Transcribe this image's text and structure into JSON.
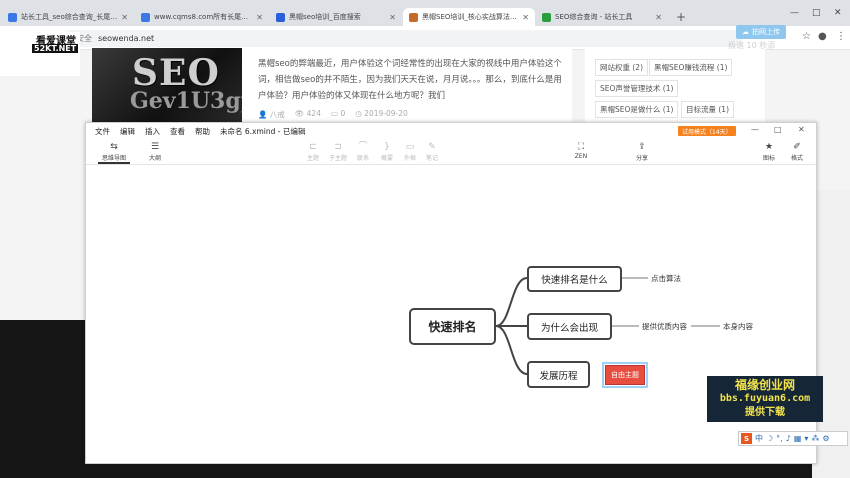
{
  "browser": {
    "tabs": [
      {
        "title": "站长工具_seo综合查询_长尾关键",
        "color": "#3b78e7",
        "active": false
      },
      {
        "title": "www.cqms8.com所有长尾词排",
        "color": "#3b78e7",
        "active": false
      },
      {
        "title": "黑帽seo培训_百度搜索",
        "color": "#2b5fd9",
        "active": false
      },
      {
        "title": "黑帽SEO培训_核心实战算法技术",
        "color": "#c66a2a",
        "active": true
      },
      {
        "title": "SEO综合查询 - 站长工具",
        "color": "#2a9d3c",
        "active": false
      }
    ],
    "new_tab": "+",
    "address": {
      "security": "不安全",
      "url": "seowenda.net"
    },
    "minimize": "—",
    "maximize": "□",
    "close": "✕"
  },
  "overlay_logo": {
    "line1": "看爱课堂",
    "line2": "52KT.NET"
  },
  "page": {
    "article_text": "黑帽seo的弊端最近，用户体验这个词经常性的出现在大家的视线中用户体验这个词，相信做seo的并不陌生，因为我们天天在说，月月说。。。那么，到底什么是用户体验？用户体验的体又体现在什么地方呢？我们",
    "meta": {
      "author": "八戒",
      "views": "424",
      "comments": "0",
      "date": "2019-09-20"
    },
    "image_text": {
      "big": "SEO",
      "small": "Gev1U3gp"
    },
    "tags": [
      "网站权重 (2)",
      "黑帽SEO赚钱流程 (1)",
      "SEO声誉管理技术 (1)",
      "黑帽SEO是做什么 (1)",
      "目标流量 (1)"
    ],
    "upload_badge": "拍网上传",
    "ghost_text": "极速 10 秒添"
  },
  "xmind": {
    "menu": [
      "文件",
      "编辑",
      "插入",
      "查看",
      "帮助",
      "未命名 6.xmind - 已编辑"
    ],
    "trial": "试用模式（14天）",
    "ribbon": {
      "mindmap": "思维导图",
      "outline": "大纲",
      "topic": "主题",
      "subtopic": "子主题",
      "relation": "联系",
      "summary": "概要",
      "boundary": "外框",
      "note": "笔记",
      "zen": "ZEN",
      "share": "分享",
      "icon": "图标",
      "format": "格式"
    },
    "mindmap": {
      "root": "快速排名",
      "children": [
        {
          "label": "快速排名是什么",
          "leaves": [
            "点击算法"
          ]
        },
        {
          "label": "为什么会出现",
          "leaves": [
            "提供优质内容",
            "本身内容"
          ]
        },
        {
          "label": "发展历程",
          "leaves": []
        }
      ],
      "floating_topic": "自由主题"
    }
  },
  "watermark_ad": {
    "line1": "福缘创业网",
    "line2": "bbs.fuyuan6.com",
    "line3": "提供下载"
  },
  "ime": {
    "logo": "S",
    "mode": "中"
  },
  "colors": {
    "accent": "#f5821f",
    "floating": "#e84e40",
    "ad_bg": "#152637",
    "ad_text": "#f3e34c"
  }
}
